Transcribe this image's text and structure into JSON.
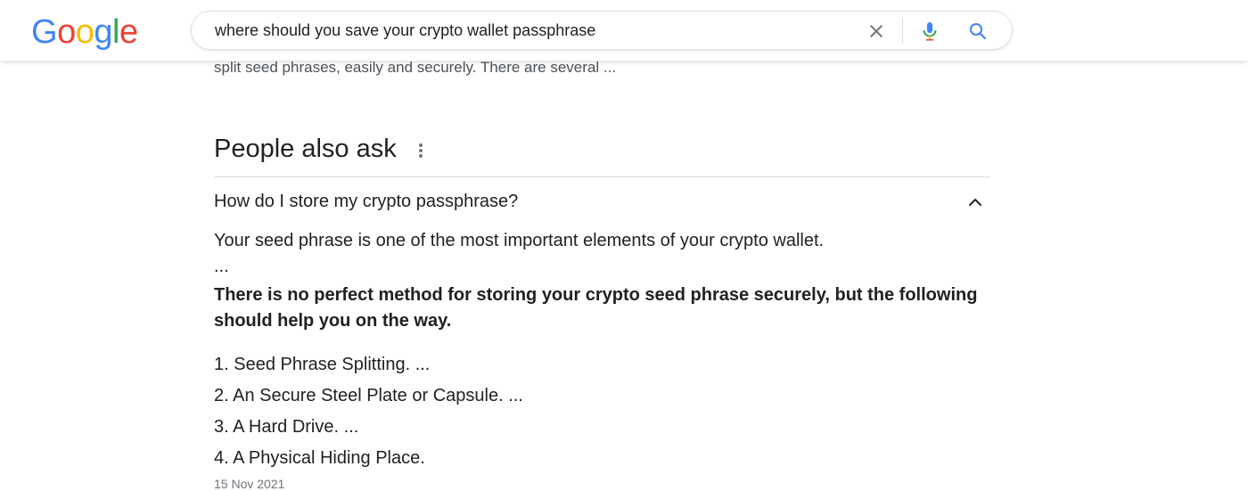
{
  "header": {
    "logo": "Google",
    "search": {
      "query": "where should you save your crypto wallet passphrase"
    },
    "icons": {
      "clear": "close-icon",
      "voice": "microphone-icon",
      "search": "search-icon"
    }
  },
  "results": {
    "snippet_tail": "split seed phrases, easily and securely. There are several ..."
  },
  "people_also_ask": {
    "title": "People also ask",
    "more_icon": "more-vert-icon",
    "question": "How do I store my crypto passphrase?",
    "expanded": true,
    "answer": {
      "lead": "Your seed phrase is one of the most important elements of your crypto wallet.",
      "ellipsis": "...",
      "bold": "There is no perfect method for storing your crypto seed phrase securely, but the following should help you on the way.",
      "list": [
        "1. Seed Phrase Splitting. ...",
        "2. An Secure Steel Plate or Capsule. ...",
        "3. A Hard Drive. ...",
        "4. A Physical Hiding Place."
      ],
      "date": "15 Nov 2021"
    }
  },
  "colors": {
    "logo_blue": "#4285F4",
    "logo_red": "#EA4335",
    "logo_yellow": "#FBBC05",
    "logo_green": "#34A853",
    "text": "#202124",
    "secondary_text": "#4d5156",
    "divider": "#dadce0",
    "icon_gray": "#70757a",
    "search_blue": "#4285F4"
  }
}
